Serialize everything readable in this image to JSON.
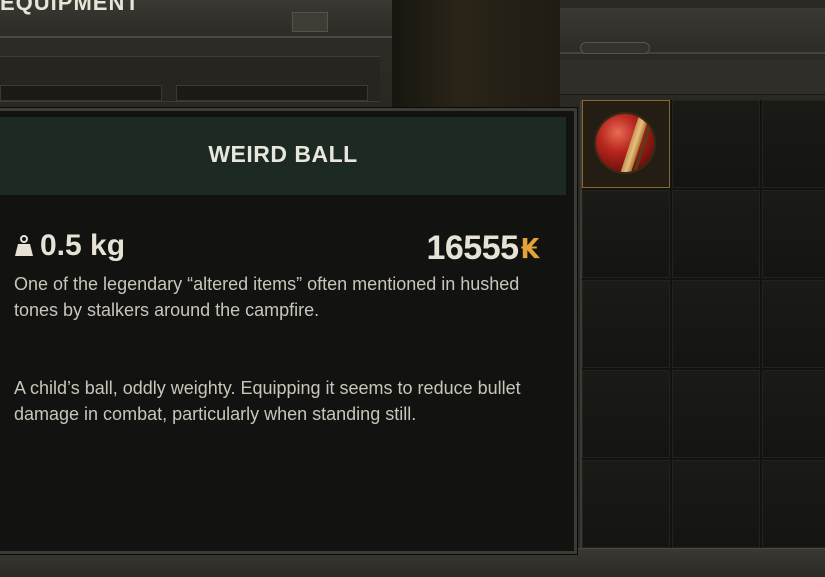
{
  "equipment_panel": {
    "title": "EQUIPMENT"
  },
  "tooltip": {
    "item_name": "WEIRD BALL",
    "weight": "0.5 kg",
    "price": "16555",
    "currency_symbol": "₭",
    "description_1": "One of the legendary “altered items” often mentioned in hushed tones by stalkers around the campfire.",
    "description_2": "A child’s ball, oddly weighty. Equipping it seems to reduce bullet damage in combat, particularly when standing still."
  },
  "inventory": {
    "slots": [
      {
        "item": "weird-ball",
        "icon": "ball-icon"
      }
    ]
  },
  "colors": {
    "accent_currency": "#e3a23a",
    "header_bg": "#1d2a24",
    "slot_border": "#8a6a2c"
  }
}
